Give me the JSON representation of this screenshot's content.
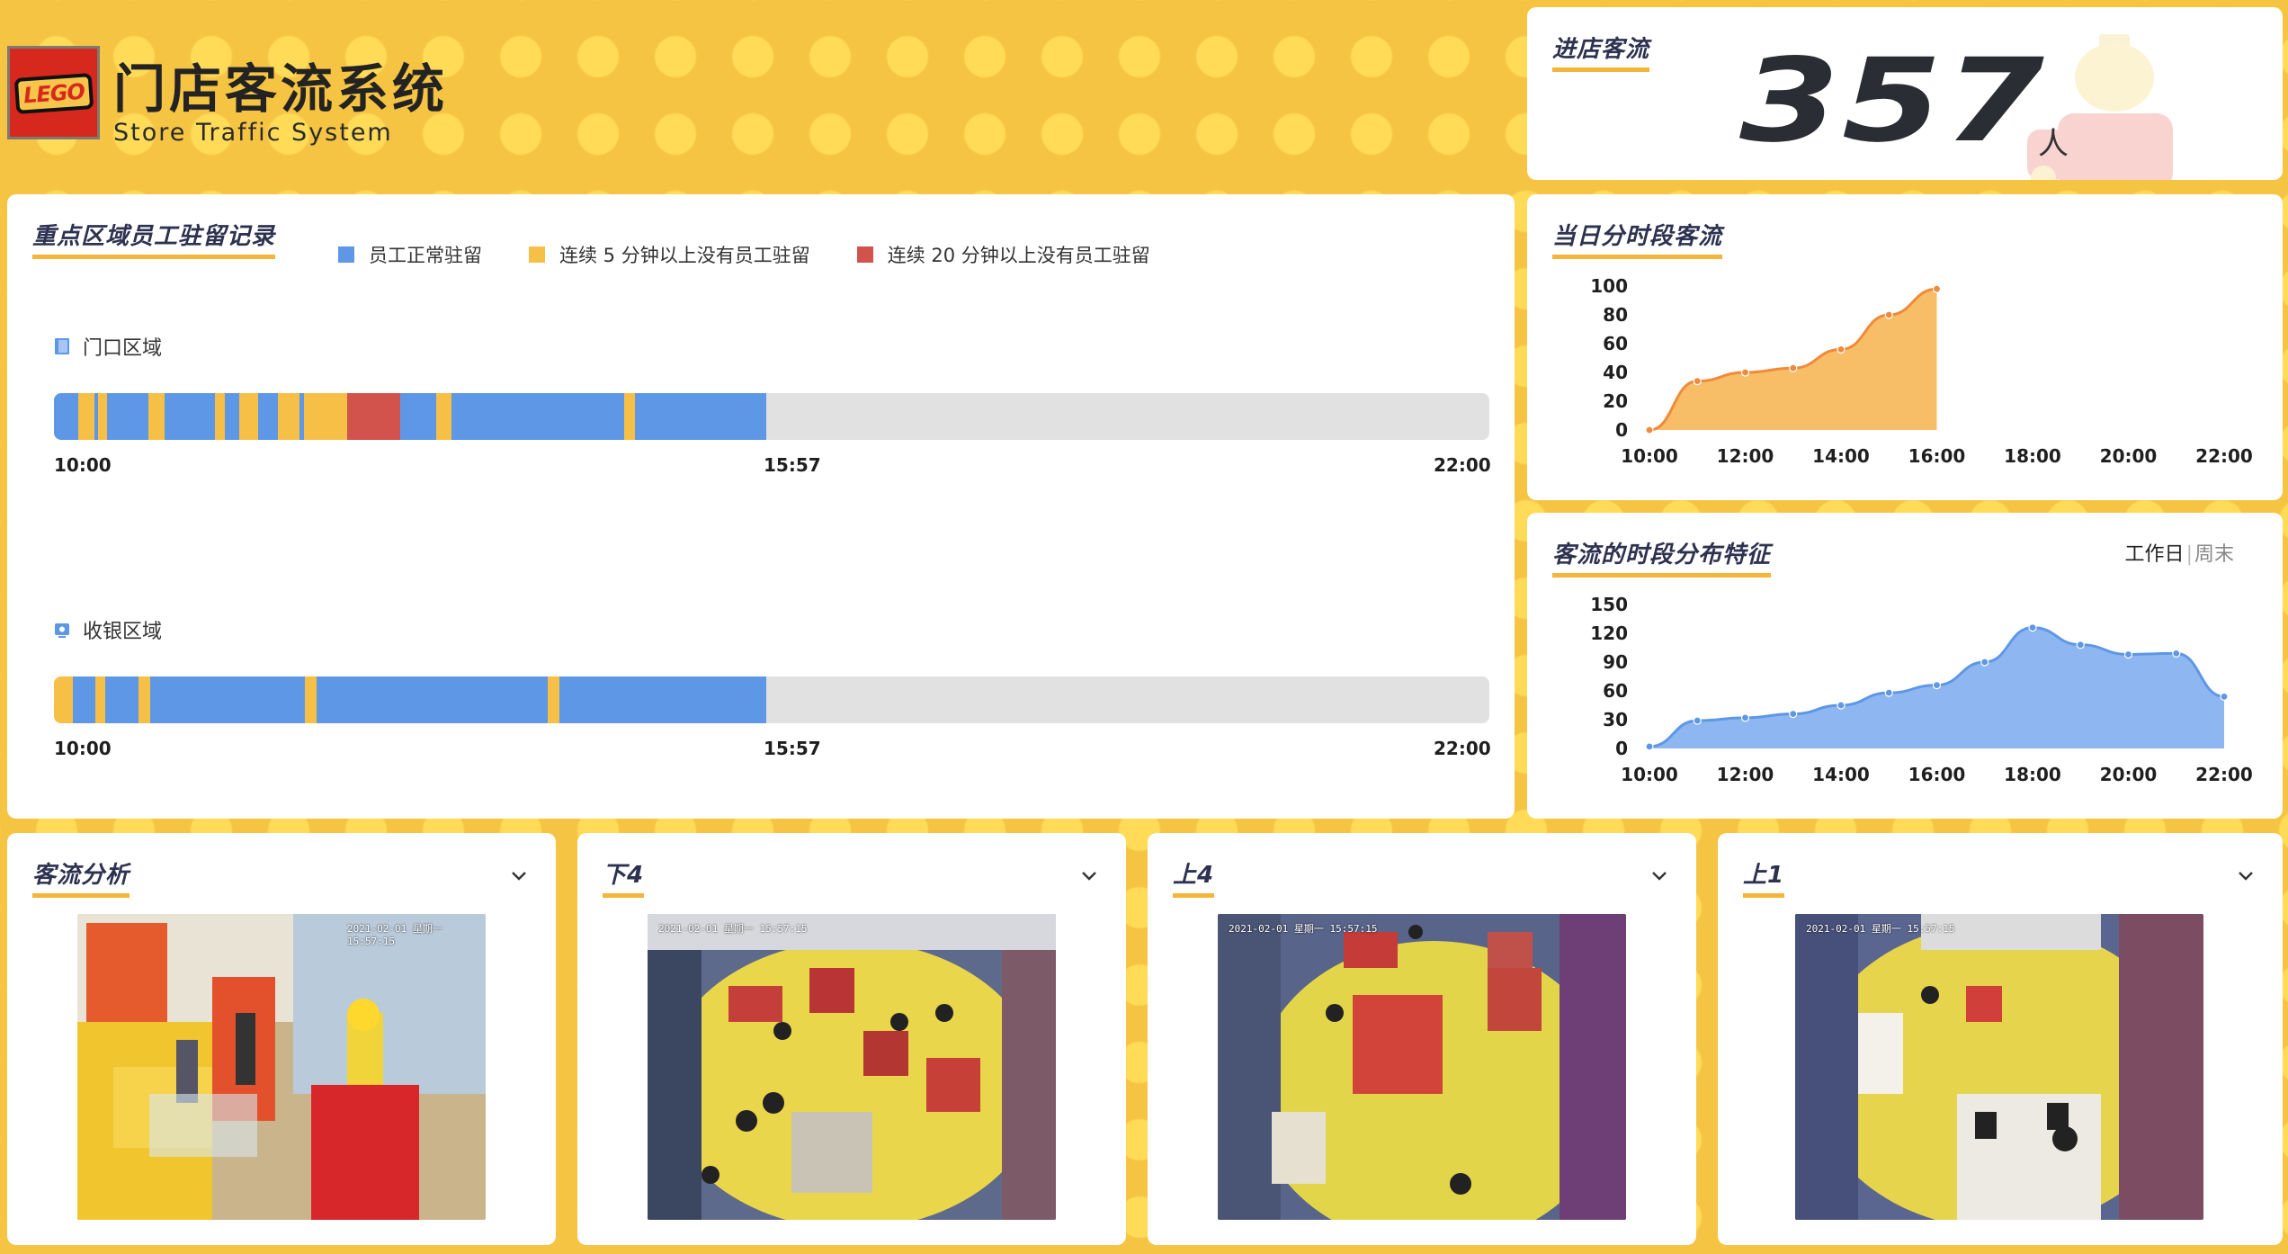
{
  "header": {
    "logo_text": "LEGO",
    "title": "门店客流系统",
    "subtitle": "Store Traffic System"
  },
  "entry": {
    "title": "进店客流",
    "count": "357",
    "unit": "人"
  },
  "dwell": {
    "title": "重点区域员工驻留记录",
    "legend": [
      {
        "label": "员工正常驻留",
        "color": "#5e97e6"
      },
      {
        "label": "连续 5 分钟以上没有员工驻留",
        "color": "#f6bf45"
      },
      {
        "label": "连续 20 分钟以上没有员工驻留",
        "color": "#d2534b"
      }
    ],
    "zones": [
      {
        "name": "门口区域",
        "icon": "door-icon",
        "start": "10:00",
        "current": "15:57",
        "end": "22:00",
        "segments": [
          {
            "from": 0,
            "to": 0.017,
            "status": "normal"
          },
          {
            "from": 0.017,
            "to": 0.028,
            "status": "warn"
          },
          {
            "from": 0.028,
            "to": 0.031,
            "status": "normal"
          },
          {
            "from": 0.031,
            "to": 0.037,
            "status": "warn"
          },
          {
            "from": 0.037,
            "to": 0.066,
            "status": "normal"
          },
          {
            "from": 0.066,
            "to": 0.077,
            "status": "warn"
          },
          {
            "from": 0.077,
            "to": 0.112,
            "status": "normal"
          },
          {
            "from": 0.112,
            "to": 0.119,
            "status": "warn"
          },
          {
            "from": 0.119,
            "to": 0.129,
            "status": "normal"
          },
          {
            "from": 0.129,
            "to": 0.142,
            "status": "warn"
          },
          {
            "from": 0.142,
            "to": 0.156,
            "status": "normal"
          },
          {
            "from": 0.156,
            "to": 0.171,
            "status": "warn"
          },
          {
            "from": 0.171,
            "to": 0.174,
            "status": "normal"
          },
          {
            "from": 0.174,
            "to": 0.204,
            "status": "warn"
          },
          {
            "from": 0.204,
            "to": 0.241,
            "status": "alert"
          },
          {
            "from": 0.241,
            "to": 0.266,
            "status": "normal"
          },
          {
            "from": 0.266,
            "to": 0.277,
            "status": "warn"
          },
          {
            "from": 0.277,
            "to": 0.397,
            "status": "normal"
          },
          {
            "from": 0.397,
            "to": 0.405,
            "status": "warn"
          },
          {
            "from": 0.405,
            "to": 0.496,
            "status": "normal"
          }
        ]
      },
      {
        "name": "收银区域",
        "icon": "monitor-icon",
        "start": "10:00",
        "current": "15:57",
        "end": "22:00",
        "segments": [
          {
            "from": 0,
            "to": 0.013,
            "status": "warn"
          },
          {
            "from": 0.013,
            "to": 0.029,
            "status": "normal"
          },
          {
            "from": 0.029,
            "to": 0.036,
            "status": "warn"
          },
          {
            "from": 0.036,
            "to": 0.059,
            "status": "normal"
          },
          {
            "from": 0.059,
            "to": 0.067,
            "status": "warn"
          },
          {
            "from": 0.067,
            "to": 0.175,
            "status": "normal"
          },
          {
            "from": 0.175,
            "to": 0.183,
            "status": "warn"
          },
          {
            "from": 0.183,
            "to": 0.344,
            "status": "normal"
          },
          {
            "from": 0.344,
            "to": 0.352,
            "status": "warn"
          },
          {
            "from": 0.352,
            "to": 0.496,
            "status": "normal"
          }
        ]
      }
    ]
  },
  "hourly": {
    "title": "当日分时段客流",
    "chart_data": {
      "type": "area",
      "x_ticks": [
        "10:00",
        "12:00",
        "14:00",
        "16:00",
        "18:00",
        "20:00",
        "22:00"
      ],
      "y_ticks": [
        "0",
        "20",
        "40",
        "60",
        "80",
        "100"
      ],
      "ylim": [
        0,
        100
      ],
      "xlim_hours": [
        10,
        22
      ],
      "points": [
        [
          10,
          0
        ],
        [
          11,
          34
        ],
        [
          12,
          40
        ],
        [
          13,
          43
        ],
        [
          14,
          56
        ],
        [
          15,
          80
        ],
        [
          16,
          98
        ]
      ],
      "color": "#f08a3c",
      "fill": "#f6b24c"
    }
  },
  "pattern": {
    "title": "客流的时段分布特征",
    "tab_active": "工作日",
    "tab_sep": "|",
    "tab_inactive": "周末",
    "chart_data": {
      "type": "area",
      "x_ticks": [
        "10:00",
        "12:00",
        "14:00",
        "16:00",
        "18:00",
        "20:00",
        "22:00"
      ],
      "y_ticks": [
        "0",
        "30",
        "60",
        "90",
        "120",
        "150"
      ],
      "ylim": [
        0,
        150
      ],
      "xlim_hours": [
        10,
        22
      ],
      "points": [
        [
          10,
          2
        ],
        [
          11,
          29
        ],
        [
          12,
          32
        ],
        [
          13,
          36
        ],
        [
          14,
          45
        ],
        [
          15,
          58
        ],
        [
          16,
          66
        ],
        [
          17,
          90
        ],
        [
          18,
          126
        ],
        [
          19,
          108
        ],
        [
          20,
          98
        ],
        [
          21,
          99
        ],
        [
          22,
          54
        ]
      ],
      "color": "#5e97e6",
      "fill": "#7aaaf0"
    }
  },
  "cameras": [
    {
      "title": "客流分析",
      "timestamp": "2021-02-01 星期一 15:57:15",
      "scene": "entrance"
    },
    {
      "title": "下4",
      "timestamp": "2021-02-01 星期一 15:57:15",
      "scene": "floor-a"
    },
    {
      "title": "上4",
      "timestamp": "2021-02-01 星期一 15:57:15",
      "scene": "floor-b"
    },
    {
      "title": "上1",
      "timestamp": "2021-02-01 星期一 15:57:15",
      "scene": "cashier"
    }
  ]
}
